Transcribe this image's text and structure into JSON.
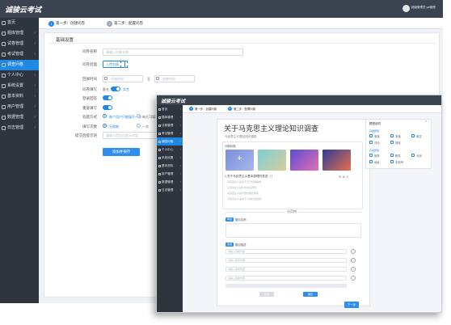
{
  "app": {
    "brand": "诚骏云考试",
    "user_label": "超级管理员 yw管理"
  },
  "back": {
    "nav": [
      {
        "label": "首页",
        "arrow": false
      },
      {
        "label": "题库管理",
        "arrow": true
      },
      {
        "label": "试卷管理",
        "arrow": true
      },
      {
        "label": "考试管理",
        "arrow": true
      },
      {
        "label": "调查问卷",
        "arrow": true,
        "active": true
      },
      {
        "label": "个人中心",
        "arrow": true
      },
      {
        "label": "系统设置",
        "arrow": true
      },
      {
        "label": "基本资料",
        "arrow": true
      },
      {
        "label": "用户管理",
        "arrow": true
      },
      {
        "label": "数据管理",
        "arrow": true
      },
      {
        "label": "日志管理",
        "arrow": true
      }
    ],
    "steps": [
      {
        "num": "1",
        "label": "第一步：创建问卷"
      },
      {
        "num": "2",
        "label": "第二步：配置问卷"
      }
    ],
    "section_title": "基础设置",
    "form": {
      "name_label": "问卷名称",
      "name_placeholder": "请输入问卷名称",
      "cover_label": "问卷封面",
      "cover_button": "上传封面",
      "time_label": "回收时间",
      "time_start": "开始时间",
      "time_sep": "至",
      "time_end": "结束时间",
      "anon_label": "问卷填写",
      "anon_off": "匿名",
      "anon_on": "实名",
      "login_label": "登录回答",
      "multi_label": "重复填写",
      "range_label": "答题方式",
      "range_opt1": "每个用户只能填写一次",
      "range_opt2": "每天可填写",
      "limit_label": "填写次数",
      "limit_opt1": "无限制",
      "limit_opt2": "一次",
      "tip_label": "提交后提示语",
      "tip_placeholder": "请输入提交后提示内容",
      "submit": "添加并保存"
    }
  },
  "front": {
    "nav": [
      {
        "label": "首页"
      },
      {
        "label": "题库管理"
      },
      {
        "label": "试卷管理"
      },
      {
        "label": "考试管理"
      },
      {
        "label": "调查问卷",
        "active": true
      },
      {
        "label": "个人中心"
      },
      {
        "label": "系统设置"
      },
      {
        "label": "基本资料"
      },
      {
        "label": "用户管理"
      },
      {
        "label": "数据管理"
      },
      {
        "label": "日志管理"
      }
    ],
    "steps": [
      {
        "num": "1",
        "label": "第一步：创建问卷"
      },
      {
        "num": "2",
        "label": "第二步：配置问卷"
      }
    ],
    "survey": {
      "title": "关于马克思主义理论知识调查",
      "intro": "马克思主义理论知识调查",
      "q_label": "问题标题",
      "q_text": "1.关于马克思主义基本原理的表述（ ）",
      "options": [
        "马克思主义是关于无产阶级解放",
        "马克思主义是科学的世界观",
        "马克思主义是开放的理论体系",
        "马克思主义是关于人类社会发展"
      ],
      "divider": "分页符",
      "block1_tag": "单选",
      "block1_label": "题目名称",
      "block2_tag": "多选",
      "block2_label": "题目描述",
      "inputs": [
        "请输入选项内容",
        "请输入选项内容",
        "请输入选项内容",
        "请输入选项内容"
      ],
      "cancel": "取消",
      "confirm": "确定",
      "next": "下一步"
    },
    "widgets": {
      "title": "题型组件",
      "group1": "基础题型",
      "row1": [
        "单选",
        "多选",
        "填空"
      ],
      "row2": [
        "评分",
        "排序"
      ],
      "group2": "高级题型",
      "row3": [
        "矩阵",
        "附件",
        "分页"
      ],
      "row4": [
        "地址",
        "手机号"
      ]
    }
  }
}
